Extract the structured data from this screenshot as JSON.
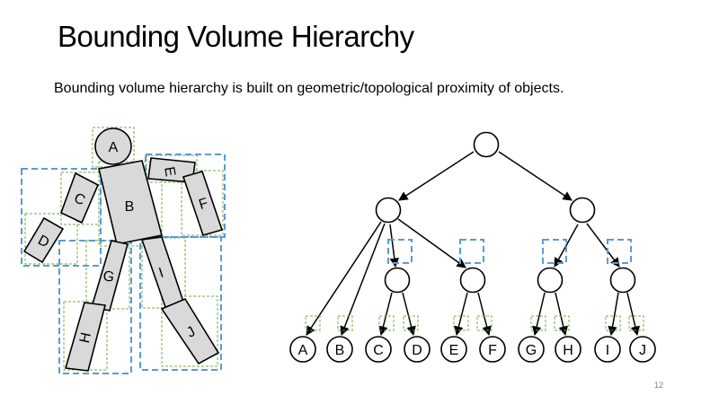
{
  "slide": {
    "title": "Bounding Volume Hierarchy",
    "subtitle": "Bounding volume hierarchy is built on geometric/topological proximity of objects.",
    "page_number": "12"
  },
  "figure_labels": [
    "A",
    "B",
    "C",
    "D",
    "E",
    "F",
    "G",
    "H",
    "I",
    "J"
  ],
  "tree": {
    "leaves": [
      "A",
      "B",
      "C",
      "D",
      "E",
      "F",
      "G",
      "H",
      "I",
      "J"
    ]
  },
  "colors": {
    "part_fill": "#d9d9d9",
    "outer_box": "#5b9bd5",
    "inner_box": "#70ad47"
  }
}
